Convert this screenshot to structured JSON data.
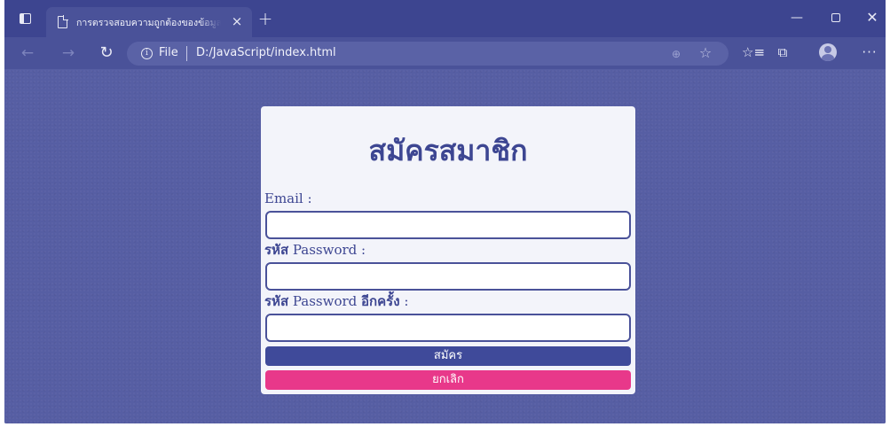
{
  "browser": {
    "tab": {
      "title": "การตรวจสอบความถูกต้องของข้อมูลใน",
      "close_symbol": "×"
    },
    "new_tab_symbol": "+",
    "window_controls": {
      "minimize": "—",
      "close": "✕"
    },
    "nav": {
      "back": "←",
      "forward": "→",
      "refresh": "↻"
    },
    "address": {
      "info_symbol": "i",
      "scheme": "File",
      "path": "D:/JavaScript/index.html"
    },
    "toolbar": {
      "zoom_symbol": "⊕",
      "add_favorite_symbol": "☆",
      "favorites_symbol": "☆≡",
      "collections_symbol": "⧉",
      "more_symbol": "···"
    },
    "colors": {
      "titlebar": "#3d4590",
      "viewport": "#565ea3",
      "primary": "#3d4692",
      "cancel": "#e8388a"
    }
  },
  "form": {
    "title": "สมัครสมาชิก",
    "email_label": "Email :",
    "password_label_thai": "รหัส",
    "password_label_en": " Password :",
    "confirm_label_thai": "รหัส",
    "confirm_label_en": " Password ",
    "confirm_label_suffix": "อีกครั้ง",
    "confirm_label_colon": " :",
    "email_value": "",
    "password_value": "",
    "confirm_value": "",
    "submit_label": "สมัคร",
    "cancel_label": "ยกเลิก"
  }
}
